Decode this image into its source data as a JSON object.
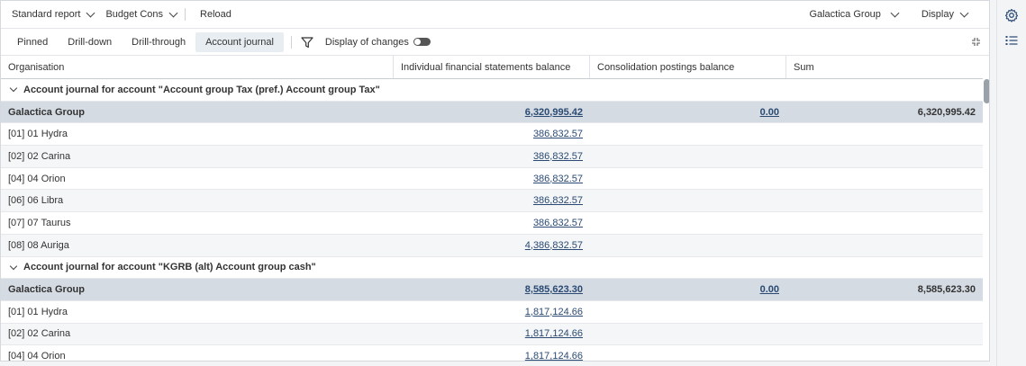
{
  "toolbar": {
    "report_label": "Standard report",
    "budget_label": "Budget Cons",
    "reload_label": "Reload",
    "group_label": "Galactica Group",
    "display_label": "Display"
  },
  "tabs": {
    "pinned": "Pinned",
    "drilldown": "Drill-down",
    "drillthrough": "Drill-through",
    "account_journal": "Account journal",
    "display_changes": "Display of changes"
  },
  "columns": {
    "organisation": "Organisation",
    "individual": "Individual financial statements balance",
    "consolidation": "Consolidation postings balance",
    "sum": "Sum"
  },
  "groups": [
    {
      "title": "Account journal for account \"Account group Tax (pref.) Account group Tax\"",
      "total": {
        "org": "Galactica Group",
        "individual": "6,320,995.42",
        "consolidation": "0.00",
        "sum": "6,320,995.42"
      },
      "rows": [
        {
          "org": "[01] 01 Hydra",
          "individual": "386,832.57"
        },
        {
          "org": "[02] 02 Carina",
          "individual": "386,832.57"
        },
        {
          "org": "[04] 04 Orion",
          "individual": "386,832.57"
        },
        {
          "org": "[06] 06 Libra",
          "individual": "386,832.57"
        },
        {
          "org": "[07] 07 Taurus",
          "individual": "386,832.57"
        },
        {
          "org": "[08] 08 Auriga",
          "individual": "4,386,832.57"
        }
      ]
    },
    {
      "title": "Account journal for account \"KGRB (alt) Account group cash\"",
      "total": {
        "org": "Galactica Group",
        "individual": "8,585,623.30",
        "consolidation": "0.00",
        "sum": "8,585,623.30"
      },
      "rows": [
        {
          "org": "[01] 01 Hydra",
          "individual": "1,817,124.66"
        },
        {
          "org": "[02] 02 Carina",
          "individual": "1,817,124.66"
        },
        {
          "org": "[04] 04 Orion",
          "individual": "1,817,124.66"
        }
      ]
    }
  ],
  "icons": {
    "settings": "gear-icon",
    "list": "list-icon",
    "filter": "filter-icon",
    "collapse": "collapse-icon"
  }
}
